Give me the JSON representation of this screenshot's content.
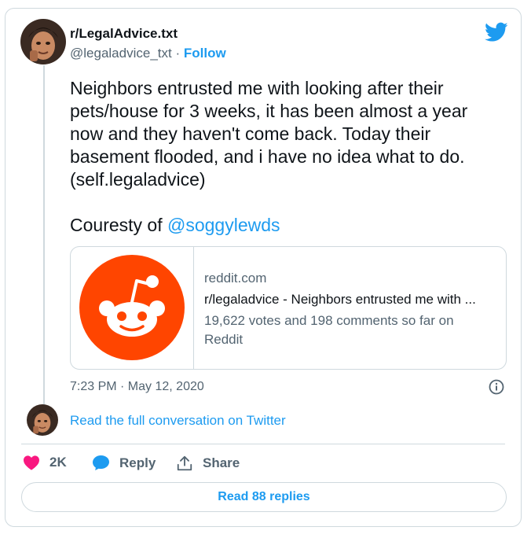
{
  "author": {
    "name": "r/LegalAdvice.txt",
    "handle": "@legaladvice_txt",
    "separator": "·",
    "follow_label": "Follow"
  },
  "tweet": {
    "text_lines": [
      "Neighbors entrusted me with looking after their",
      "pets/house for 3 weeks, it has been almost a year",
      "now and they haven't come back. Today their",
      "basement flooded, and i have no idea what to do.",
      "(self.legaladvice)"
    ],
    "courtesy_prefix": "Couresty of",
    "mention": "@soggylewds"
  },
  "link_card": {
    "domain": "reddit.com",
    "title": "r/legaladvice - Neighbors entrusted me with ...",
    "description": "19,622 votes and 198 comments so far on Reddit"
  },
  "timestamp": "7:23 PM · May 12, 2020",
  "read_conversation": "Read the full conversation on Twitter",
  "actions": {
    "likes": "2K",
    "reply": "Reply",
    "share": "Share"
  },
  "read_replies": "Read 88 replies",
  "colors": {
    "accent": "#1d9bf0",
    "like": "#f91880",
    "reddit": "#ff4500"
  }
}
